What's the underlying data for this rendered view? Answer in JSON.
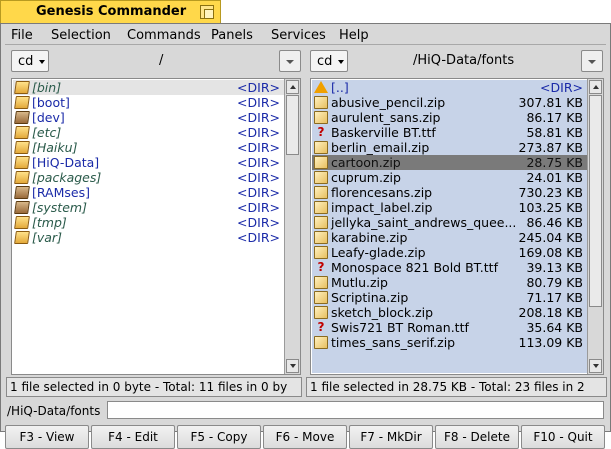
{
  "window": {
    "title": "Genesis Commander"
  },
  "menu": [
    "File",
    "Selection",
    "Commands",
    "Panels",
    "Services",
    "Help"
  ],
  "left_panel": {
    "cd_label": "cd",
    "path": "/",
    "rows": [
      {
        "name": "[bin]",
        "size": "<DIR>",
        "icon": "folder-icon",
        "italic": true
      },
      {
        "name": "[boot]",
        "size": "<DIR>",
        "icon": "folder-icon",
        "italic": false
      },
      {
        "name": "[dev]",
        "size": "<DIR>",
        "icon": "folder-link-icon",
        "italic": false
      },
      {
        "name": "[etc]",
        "size": "<DIR>",
        "icon": "folder-icon",
        "italic": true
      },
      {
        "name": "[Haiku]",
        "size": "<DIR>",
        "icon": "folder-icon",
        "italic": true
      },
      {
        "name": "[HiQ-Data]",
        "size": "<DIR>",
        "icon": "folder-icon",
        "italic": false
      },
      {
        "name": "[packages]",
        "size": "<DIR>",
        "icon": "folder-icon",
        "italic": true
      },
      {
        "name": "[RAMses]",
        "size": "<DIR>",
        "icon": "folder-link-icon",
        "italic": false
      },
      {
        "name": "[system]",
        "size": "<DIR>",
        "icon": "folder-link-icon",
        "italic": true
      },
      {
        "name": "[tmp]",
        "size": "<DIR>",
        "icon": "folder-icon",
        "italic": true
      },
      {
        "name": "[var]",
        "size": "<DIR>",
        "icon": "folder-icon",
        "italic": true
      }
    ],
    "status": "1 file selected in 0 byte - Total: 11 files in 0 by"
  },
  "right_panel": {
    "cd_label": "cd",
    "path": "/HiQ-Data/fonts",
    "rows": [
      {
        "name": "[..]",
        "size": "<DIR>",
        "icon": "up-icon"
      },
      {
        "name": "abusive_pencil.zip",
        "size": "307.81 KB",
        "icon": "archive-icon"
      },
      {
        "name": "aurulent_sans.zip",
        "size": "86.17 KB",
        "icon": "archive-icon"
      },
      {
        "name": "Baskerville BT.ttf",
        "size": "58.81 KB",
        "icon": "font-icon"
      },
      {
        "name": "berlin_email.zip",
        "size": "273.87 KB",
        "icon": "archive-icon"
      },
      {
        "name": "cartoon.zip",
        "size": "28.75 KB",
        "icon": "archive-icon",
        "selected": true
      },
      {
        "name": "cuprum.zip",
        "size": "24.01 KB",
        "icon": "archive-icon"
      },
      {
        "name": "florencesans.zip",
        "size": "730.23 KB",
        "icon": "archive-icon"
      },
      {
        "name": "impact_label.zip",
        "size": "103.25 KB",
        "icon": "archive-icon"
      },
      {
        "name": "jellyka_saint_andrews_quee...",
        "size": "86.46 KB",
        "icon": "archive-icon"
      },
      {
        "name": "karabine.zip",
        "size": "245.04 KB",
        "icon": "archive-icon"
      },
      {
        "name": "Leafy-glade.zip",
        "size": "169.08 KB",
        "icon": "archive-icon"
      },
      {
        "name": "Monospace 821 Bold BT.ttf",
        "size": "39.13 KB",
        "icon": "font-icon"
      },
      {
        "name": "Mutlu.zip",
        "size": "80.79 KB",
        "icon": "archive-icon"
      },
      {
        "name": "Scriptina.zip",
        "size": "71.17 KB",
        "icon": "archive-icon"
      },
      {
        "name": "sketch_block.zip",
        "size": "208.18 KB",
        "icon": "archive-icon"
      },
      {
        "name": "Swis721 BT Roman.ttf",
        "size": "35.64 KB",
        "icon": "font-icon"
      },
      {
        "name": "times_sans_serif.zip",
        "size": "113.09 KB",
        "icon": "archive-icon"
      }
    ],
    "status": "1 file selected in 28.75 KB - Total: 23 files in 2"
  },
  "command_line": {
    "path": "/HiQ-Data/fonts",
    "value": ""
  },
  "function_keys": [
    "F3 - View",
    "F4 - Edit",
    "F5 - Copy",
    "F6 - Move",
    "F7 - MkDir",
    "F8 - Delete",
    "F10 - Quit"
  ],
  "colors": {
    "title_tab": "#ffd84a",
    "selection_bg": "#c7d3e8",
    "cursor_row": "#7a7a7a",
    "dir_text": "#1a2aa8"
  }
}
